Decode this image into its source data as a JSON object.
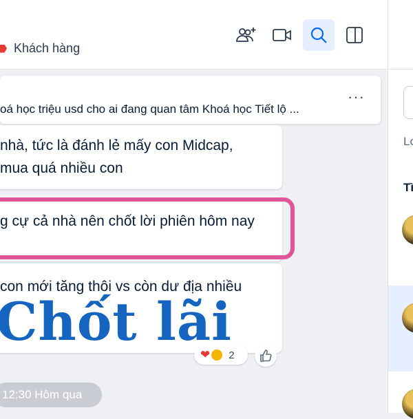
{
  "header": {
    "tag_label": "Khách hàng",
    "buttons": [
      {
        "name": "add-member-icon"
      },
      {
        "name": "video-call-icon"
      },
      {
        "name": "search-icon"
      },
      {
        "name": "toggle-sidebar-icon"
      }
    ]
  },
  "pinned": {
    "text": "oá học triệu usd cho ai đang quan tâm Khoá học Tiết lộ ...",
    "more": "···"
  },
  "messages": [
    {
      "lines": [
        "nhà, tức là đánh lẻ mấy con Midcap,",
        "mua quá nhiều con"
      ]
    },
    {
      "lines": [
        "g cự cả nhà nên chốt lời phiên hôm nay"
      ]
    },
    {
      "lines": [
        "con mới tăng thôi vs còn dư địa nhiều"
      ]
    }
  ],
  "overlay_text": "Chốt lãi",
  "reactions": {
    "heart": "❤",
    "count": "2"
  },
  "timestamp": "12:30 Hôm qua",
  "right_panel": {
    "text": "Lo",
    "bold": "Tì"
  },
  "colors": {
    "accent": "#1565c0",
    "highlight": "#e0559a",
    "tag": "#e53935"
  }
}
